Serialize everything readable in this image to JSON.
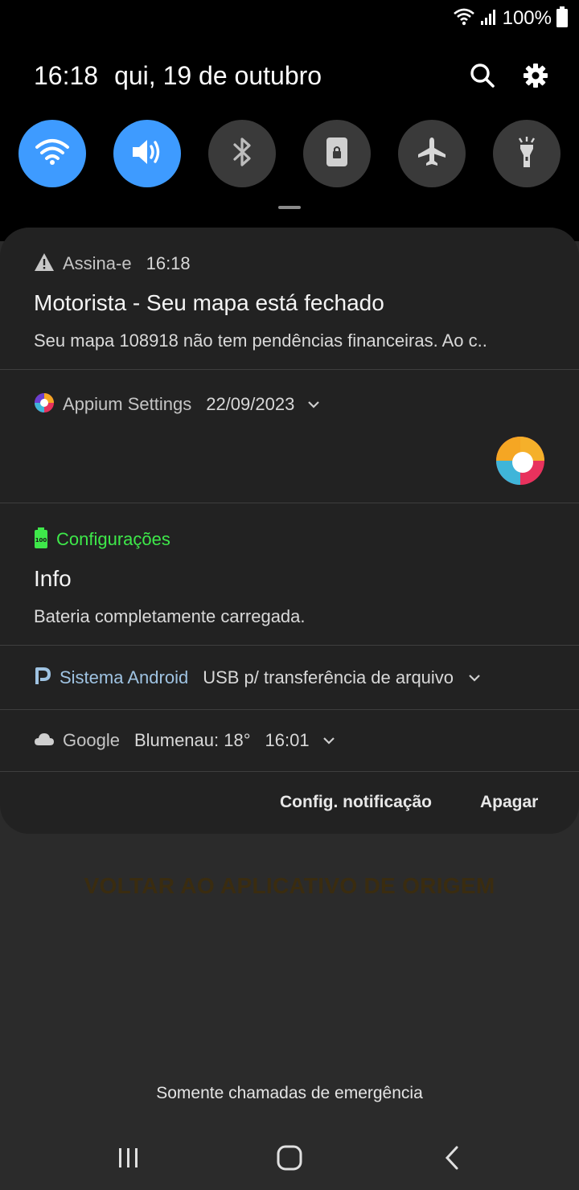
{
  "status_bar": {
    "battery": "100%"
  },
  "header": {
    "time": "16:18",
    "date": "qui, 19 de outubro"
  },
  "quick_toggles": [
    {
      "icon": "wifi-icon",
      "state": "on"
    },
    {
      "icon": "sound-icon",
      "state": "on"
    },
    {
      "icon": "bluetooth-icon",
      "state": "off"
    },
    {
      "icon": "screen-lock-icon",
      "state": "off"
    },
    {
      "icon": "airplane-icon",
      "state": "off"
    },
    {
      "icon": "flashlight-icon",
      "state": "off"
    }
  ],
  "notifications": {
    "assina": {
      "app": "Assina-e",
      "time": "16:18",
      "title": "Motorista - Seu mapa está fechado",
      "body": "Seu mapa 108918 não tem pendências financeiras. Ao c.."
    },
    "appium": {
      "app": "Appium Settings",
      "date": "22/09/2023"
    },
    "config": {
      "app": "Configurações",
      "title": "Info",
      "body": "Bateria completamente carregada.",
      "app_color": "#3ee84a"
    },
    "android": {
      "app": "Sistema Android",
      "text": "USB p/ transferência de arquivo",
      "app_color": "#9fc3e2"
    },
    "google": {
      "app": "Google",
      "weather": "Blumenau: 18°",
      "time": "16:01"
    }
  },
  "panel_actions": {
    "settings": "Config. notificação",
    "clear": "Apagar"
  },
  "background": {
    "back_to_app": "VOLTAR AO APLICATIVO DE ORIGEM",
    "emergency": "Somente chamadas de emergência"
  },
  "colors": {
    "toggle_on": "#3e9bff",
    "toggle_off": "#3a3a3a",
    "panel": "#222222"
  }
}
